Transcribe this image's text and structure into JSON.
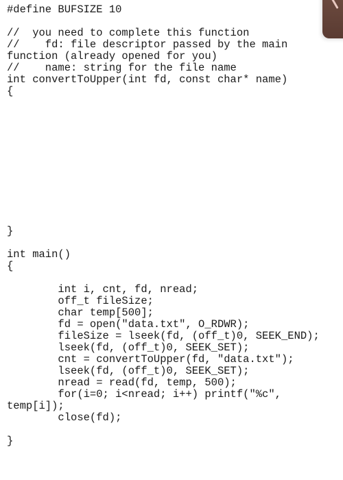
{
  "document": {
    "language": "C",
    "lines": [
      "#define BUFSIZE 10",
      "",
      "//  you need to complete this function",
      "//    fd: file descriptor passed by the main",
      "function (already opened for you)",
      "//    name: string for the file name",
      "int convertToUpper(int fd, const char* name)",
      "{",
      "",
      "",
      "",
      "",
      "",
      "",
      "",
      "",
      "",
      "",
      "",
      "}",
      "",
      "int main()",
      "{",
      "",
      "        int i, cnt, fd, nread;",
      "        off_t fileSize;",
      "        char temp[500];",
      "        fd = open(\"data.txt\", O_RDWR);",
      "        fileSize = lseek(fd, (off_t)0, SEEK_END);",
      "        lseek(fd, (off_t)0, SEEK_SET);",
      "        cnt = convertToUpper(fd, \"data.txt\");",
      "        lseek(fd, (off_t)0, SEEK_SET);",
      "        nread = read(fd, temp, 500);",
      "        for(i=0; i<nread; i++) printf(\"%c\",",
      "temp[i]);",
      "        close(fd);",
      "",
      "}"
    ]
  },
  "overlay": {
    "corner_widget_icon": "pen-tab-icon",
    "corner_widget_color": "#6e4c40"
  }
}
